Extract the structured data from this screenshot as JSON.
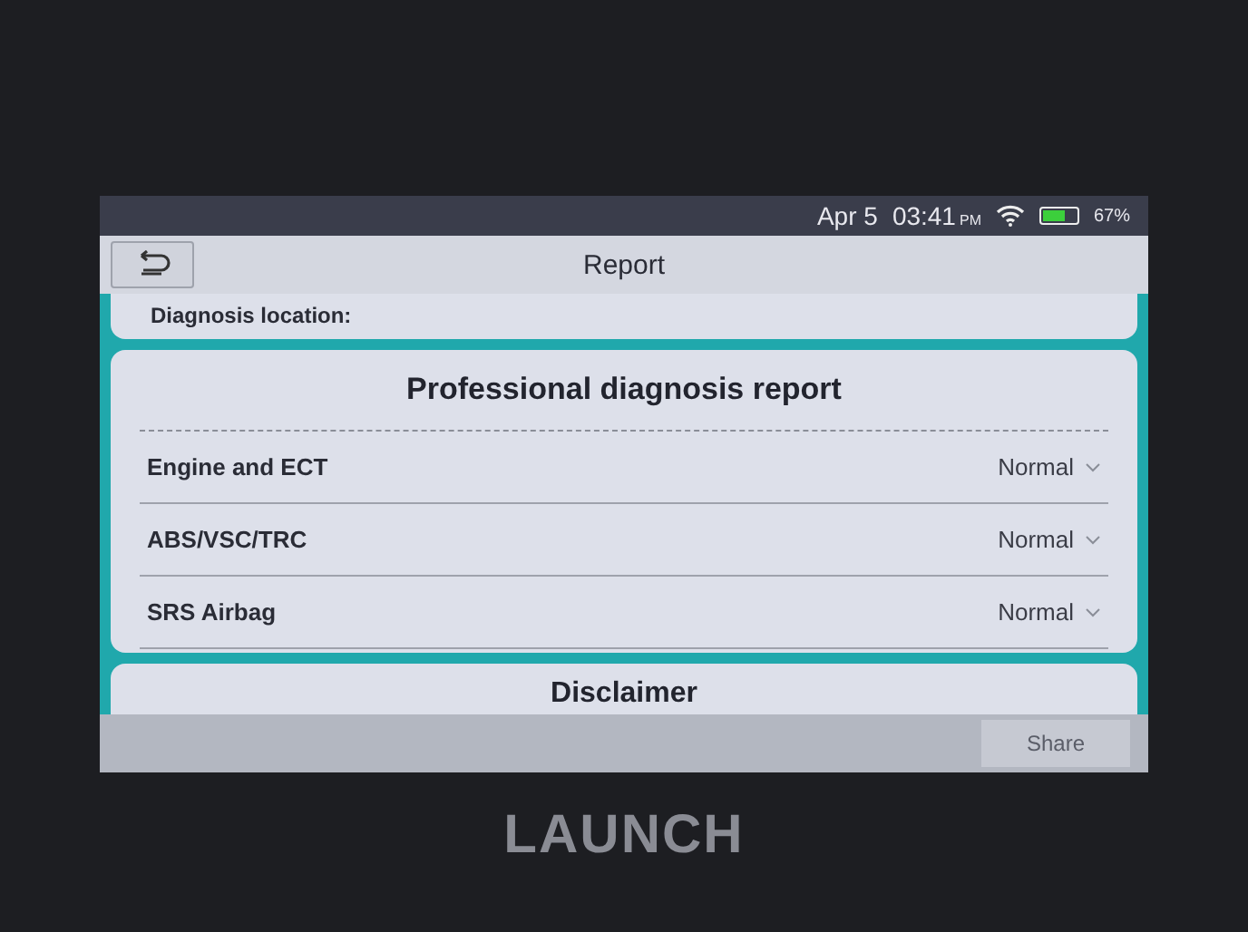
{
  "status_bar": {
    "date": "Apr 5",
    "time": "03:41",
    "ampm": "PM",
    "battery": {
      "level": 0.67
    },
    "battery_text": "67%"
  },
  "header": {
    "title": "Report"
  },
  "location": {
    "label": "Diagnosis location:"
  },
  "report": {
    "title": "Professional diagnosis report",
    "rows": [
      {
        "name": "Engine and ECT",
        "status": "Normal"
      },
      {
        "name": "ABS/VSC/TRC",
        "status": "Normal"
      },
      {
        "name": "SRS Airbag",
        "status": "Normal"
      }
    ]
  },
  "disclaimer": {
    "title": "Disclaimer"
  },
  "buttons": {
    "share": "Share"
  },
  "device": {
    "brand": "LAUNCH"
  }
}
